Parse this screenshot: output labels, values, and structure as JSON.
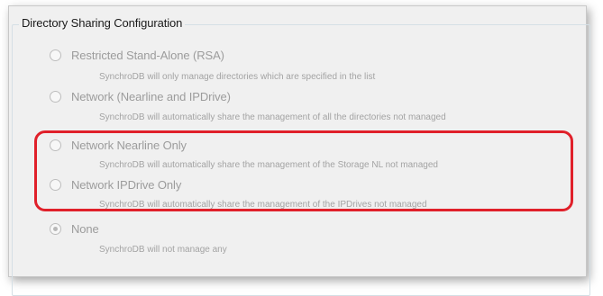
{
  "group": {
    "title": "Directory Sharing Configuration"
  },
  "options": [
    {
      "label": "Restricted Stand-Alone (RSA)",
      "description": "SynchroDB will only manage directories which are specified in the list",
      "checked": false
    },
    {
      "label": "Network (Nearline and IPDrive)",
      "description": "SynchroDB will automatically share the management of all the directories not managed",
      "checked": false
    },
    {
      "label": "Network Nearline Only",
      "description": "SynchroDB will automatically share the management of the Storage NL not managed",
      "checked": false
    },
    {
      "label": "Network IPDrive Only",
      "description": "SynchroDB will automatically share the management of the IPDrives not managed",
      "checked": false
    },
    {
      "label": "None",
      "description": "SynchroDB will not manage any",
      "checked": true
    }
  ],
  "highlight_color": "#e0202a"
}
